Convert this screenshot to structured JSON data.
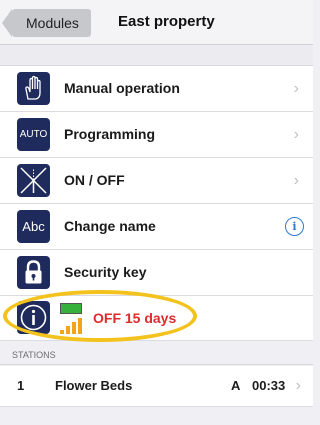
{
  "nav": {
    "back_label": "Modules",
    "title": "East property"
  },
  "menu": [
    {
      "label": "Manual operation",
      "icon": "hand-icon"
    },
    {
      "label": "Programming",
      "icon": "auto-icon",
      "icon_text": "AUTO"
    },
    {
      "label": "ON / OFF",
      "icon": "valve-off-icon"
    },
    {
      "label": "Change name",
      "icon": "abc-icon",
      "icon_text": "Abc"
    },
    {
      "label": "Security key",
      "icon": "lock-icon"
    }
  ],
  "status": {
    "label": "OFF 15 days",
    "battery_color": "#36b13c",
    "signal_color": "#f3a31c"
  },
  "stations": {
    "header": "STATIONS",
    "rows": [
      {
        "number": "1",
        "name": "Flower Beds",
        "program": "A",
        "time": "00:33"
      }
    ]
  },
  "colors": {
    "icon_bg": "#1f2b5c",
    "status_text": "#e02a2a",
    "highlight": "#f4c21d",
    "info_accent": "#2b7bd6"
  }
}
